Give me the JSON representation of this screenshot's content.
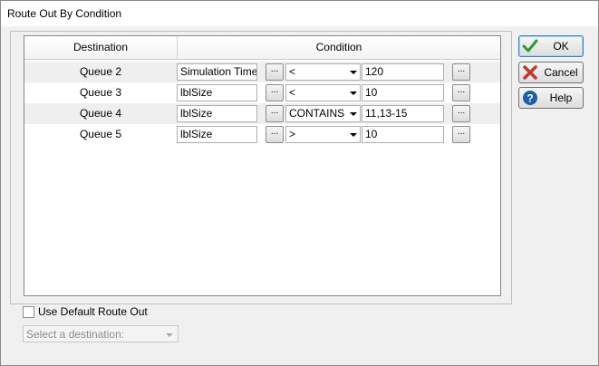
{
  "window": {
    "title": "Route Out By Condition"
  },
  "table": {
    "headers": {
      "destination": "Destination",
      "condition": "Condition"
    },
    "rows": [
      {
        "destination": "Queue 2",
        "variable": "Simulation Time",
        "operator": "<",
        "value": "120"
      },
      {
        "destination": "Queue 3",
        "variable": "lblSize",
        "operator": "<",
        "value": "10"
      },
      {
        "destination": "Queue 4",
        "variable": "lblSize",
        "operator": "CONTAINS",
        "value": "11,13-15"
      },
      {
        "destination": "Queue 5",
        "variable": "lblSize",
        "operator": ">",
        "value": "10"
      }
    ],
    "ellipsis_label": "..."
  },
  "buttons": {
    "ok": "OK",
    "cancel": "Cancel",
    "help": "Help"
  },
  "default_route": {
    "checkbox_label": "Use Default Route Out",
    "checked": false,
    "select_placeholder": "Select a destination:"
  },
  "colors": {
    "ok_check": "#2e9a2e",
    "cancel_x": "#c0392b",
    "help_blue": "#1f5fa8"
  }
}
